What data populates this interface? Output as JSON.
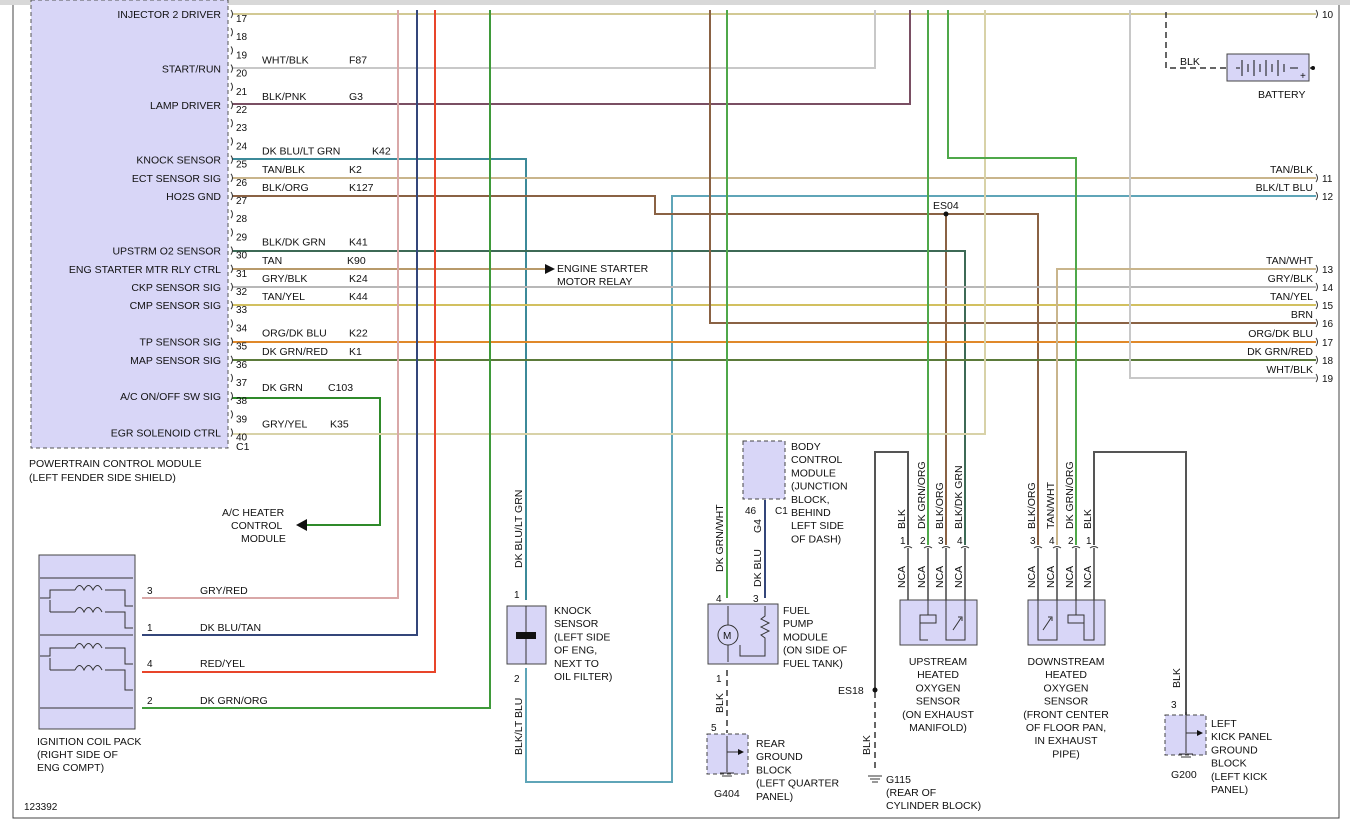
{
  "diagram_id": "123392",
  "colors": {
    "gray": "#c8c8c8",
    "pink": "#d9a8a8",
    "dkblue": "#34467a",
    "red": "#e8452a",
    "green": "#3f9a3a",
    "tan": "#c9b58c",
    "brown": "#8a6244",
    "blue": "#5fa5b8",
    "yellow": "#d2c060",
    "orange": "#e0892a",
    "darkgreen": "#3d7a35",
    "wht": "#a8a8a8",
    "teal": "#3c8a99",
    "purple": "#7a4f63",
    "box_fill": "#d8d6f7"
  },
  "pcm": {
    "name_line1": "POWERTRAIN CONTROL MODULE",
    "name_line2": "(LEFT FENDER SIDE SHIELD)",
    "connector": "C1",
    "pins": [
      {
        "num": "17",
        "label": "INJECTOR 2 DRIVER",
        "color": "",
        "circuit": ""
      },
      {
        "num": "18",
        "label": "",
        "color": "",
        "circuit": ""
      },
      {
        "num": "19",
        "label": "",
        "color": "",
        "circuit": ""
      },
      {
        "num": "20",
        "label": "START/RUN",
        "color": "WHT/BLK",
        "circuit": "F87"
      },
      {
        "num": "21",
        "label": "",
        "color": "",
        "circuit": ""
      },
      {
        "num": "22",
        "label": "LAMP DRIVER",
        "color": "BLK/PNK",
        "circuit": "G3"
      },
      {
        "num": "23",
        "label": "",
        "color": "",
        "circuit": ""
      },
      {
        "num": "24",
        "label": "",
        "color": "",
        "circuit": ""
      },
      {
        "num": "25",
        "label": "KNOCK SENSOR",
        "color": "DK BLU/LT GRN",
        "circuit": "K42"
      },
      {
        "num": "26",
        "label": "ECT SENSOR SIG",
        "color": "TAN/BLK",
        "circuit": "K2"
      },
      {
        "num": "27",
        "label": "HO2S GND",
        "color": "BLK/ORG",
        "circuit": "K127"
      },
      {
        "num": "28",
        "label": "",
        "color": "",
        "circuit": ""
      },
      {
        "num": "29",
        "label": "",
        "color": "",
        "circuit": ""
      },
      {
        "num": "30",
        "label": "UPSTRM O2 SENSOR",
        "color": "BLK/DK GRN",
        "circuit": "K41"
      },
      {
        "num": "31",
        "label": "ENG STARTER MTR RLY CTRL",
        "color": "TAN",
        "circuit": "K90"
      },
      {
        "num": "32",
        "label": "CKP SENSOR SIG",
        "color": "GRY/BLK",
        "circuit": "K24"
      },
      {
        "num": "33",
        "label": "CMP SENSOR SIG",
        "color": "TAN/YEL",
        "circuit": "K44"
      },
      {
        "num": "34",
        "label": "",
        "color": "",
        "circuit": ""
      },
      {
        "num": "35",
        "label": "TP SENSOR SIG",
        "color": "ORG/DK BLU",
        "circuit": "K22"
      },
      {
        "num": "36",
        "label": "MAP SENSOR SIG",
        "color": "DK GRN/RED",
        "circuit": "K1"
      },
      {
        "num": "37",
        "label": "",
        "color": "",
        "circuit": ""
      },
      {
        "num": "38",
        "label": "A/C ON/OFF SW SIG",
        "color": "DK GRN",
        "circuit": "C103"
      },
      {
        "num": "39",
        "label": "",
        "color": "",
        "circuit": ""
      },
      {
        "num": "40",
        "label": "EGR SOLENOID CTRL",
        "color": "GRY/YEL",
        "circuit": "K35"
      }
    ]
  },
  "right_connector": {
    "pins": [
      {
        "num": "10",
        "color": ""
      },
      {
        "num": "11",
        "color": "TAN/BLK"
      },
      {
        "num": "12",
        "color": "BLK/LT BLU"
      },
      {
        "num": "13",
        "color": "TAN/WHT"
      },
      {
        "num": "14",
        "color": "GRY/BLK"
      },
      {
        "num": "15",
        "color": "TAN/YEL"
      },
      {
        "num": "16",
        "color": "BRN"
      },
      {
        "num": "17",
        "color": "ORG/DK BLU"
      },
      {
        "num": "18",
        "color": "DK GRN/RED"
      },
      {
        "num": "19",
        "color": "WHT/BLK"
      }
    ]
  },
  "battery": {
    "label": "BATTERY",
    "wire": "BLK"
  },
  "splice": {
    "label": "ES04"
  },
  "starter_relay": {
    "line1": "ENGINE STARTER",
    "line2": "MOTOR RELAY"
  },
  "ac_heater": {
    "line1": "A/C HEATER",
    "line2": "CONTROL",
    "line3": "MODULE"
  },
  "coil_pack": {
    "line1": "IGNITION COIL PACK",
    "line2": "(RIGHT SIDE OF",
    "line3": "ENG COMPT)",
    "pins": [
      {
        "num": "3",
        "color": "GRY/RED"
      },
      {
        "num": "1",
        "color": "DK BLU/TAN"
      },
      {
        "num": "4",
        "color": "RED/YEL"
      },
      {
        "num": "2",
        "color": "DK GRN/ORG"
      }
    ]
  },
  "knock_sensor": {
    "lines": [
      "KNOCK",
      "SENSOR",
      "(LEFT SIDE",
      "OF ENG,",
      "NEXT TO",
      "OIL FILTER)"
    ],
    "pin_top": "1",
    "pin_bottom": "2",
    "wire_top": "DK BLU/LT GRN",
    "wire_bottom": "BLK/LT BLU"
  },
  "bcm": {
    "lines": [
      "BODY",
      "CONTROL",
      "MODULE",
      "(JUNCTION",
      "BLOCK,",
      "BEHIND",
      "LEFT SIDE",
      "OF DASH)"
    ],
    "pin": "46",
    "connector": "C1"
  },
  "fuel_pump": {
    "lines": [
      "FUEL",
      "PUMP",
      "MODULE",
      "(ON SIDE OF",
      "FUEL TANK)"
    ],
    "pin4": "4",
    "pin3": "3",
    "pin1": "1",
    "wire4": "DK GRN/WHT",
    "wire3_a": "G4",
    "wire3_b": "DK BLU",
    "wire1": "BLK",
    "motor": "M"
  },
  "rear_ground": {
    "lines": [
      "REAR",
      "GROUND",
      "BLOCK",
      "(LEFT QUARTER",
      "PANEL)"
    ],
    "pin": "5",
    "ground": "G404"
  },
  "upstream_o2": {
    "lines": [
      "UPSTREAM",
      "HEATED",
      "OXYGEN",
      "SENSOR",
      "(ON EXHAUST",
      "MANIFOLD)"
    ],
    "pins": [
      {
        "num": "1",
        "wire": "BLK",
        "nca": "NCA"
      },
      {
        "num": "2",
        "wire": "DK GRN/ORG",
        "nca": "NCA"
      },
      {
        "num": "3",
        "wire": "BLK/ORG",
        "nca": "NCA"
      },
      {
        "num": "4",
        "wire": "BLK/DK GRN",
        "nca": "NCA"
      }
    ]
  },
  "downstream_o2": {
    "lines": [
      "DOWNSTREAM",
      "HEATED",
      "OXYGEN",
      "SENSOR",
      "(FRONT CENTER",
      "OF FLOOR PAN,",
      "IN EXHAUST",
      "PIPE)"
    ],
    "pins": [
      {
        "num": "3",
        "wire": "BLK/ORG",
        "nca": "NCA"
      },
      {
        "num": "4",
        "wire": "TAN/WHT",
        "nca": "NCA"
      },
      {
        "num": "2",
        "wire": "DK GRN/ORG",
        "nca": "NCA"
      },
      {
        "num": "1",
        "wire": "BLK",
        "nca": "NCA"
      }
    ]
  },
  "es18": {
    "label": "ES18",
    "wire": "BLK"
  },
  "g115": {
    "line1": "G115",
    "line2": "(REAR OF",
    "line3": "CYLINDER BLOCK)"
  },
  "kick_panel": {
    "lines": [
      "LEFT",
      "KICK PANEL",
      "GROUND",
      "BLOCK",
      "(LEFT KICK",
      "PANEL)"
    ],
    "pin": "3",
    "wire": "BLK",
    "ground": "G200"
  }
}
